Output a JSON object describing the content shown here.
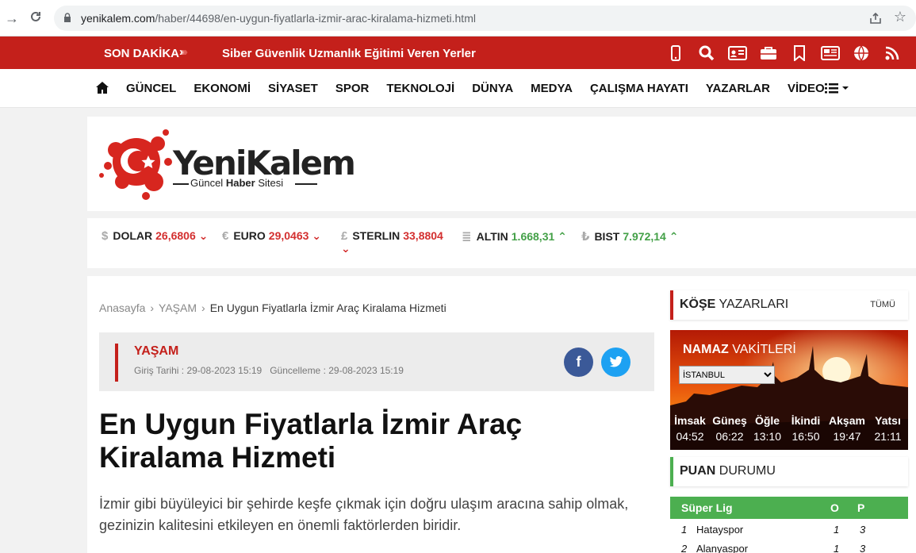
{
  "browser": {
    "url_domain": "yenikalem.com",
    "url_path": "/haber/44698/en-uygun-fiyatlarla-izmir-arac-kiralama-hizmeti.html"
  },
  "breaking": {
    "label": "SON DAKİKA",
    "headline": "Siber Güvenlik Uzmanlık Eğitimi Veren Yerler",
    "icons": [
      "mobile-icon",
      "search-icon",
      "id-card-icon",
      "briefcase-icon",
      "bookmark-icon",
      "newspaper-icon",
      "globe-icon",
      "rss-icon"
    ]
  },
  "nav": {
    "items": [
      "GÜNCEL",
      "EKONOMİ",
      "SİYASET",
      "SPOR",
      "TEKNOLOJİ",
      "DÜNYA",
      "MEDYA",
      "ÇALIŞMA HAYATI",
      "YAZARLAR",
      "VİDEO"
    ]
  },
  "logo": {
    "name": "YeniKalem",
    "sub_pre": "Güncel",
    "sub_bold": "Haber",
    "sub_post": "Sitesi"
  },
  "currency": {
    "items": [
      {
        "symbol": "$",
        "name": "DOLAR",
        "value": "26,6806",
        "trend": "down"
      },
      {
        "symbol": "€",
        "name": "EURO",
        "value": "29,0463",
        "trend": "down"
      },
      {
        "symbol": "£",
        "name": "STERLIN",
        "value": "33,8804",
        "trend": "down"
      },
      {
        "symbol": "≣",
        "name": "ALTIN",
        "value": "1.668,31",
        "trend": "up"
      },
      {
        "symbol": "₺",
        "name": "BIST",
        "value": "7.972,14",
        "trend": "up"
      }
    ]
  },
  "breadcrumb": {
    "home": "Anasayfa",
    "category": "YAŞAM",
    "current": "En Uygun Fiyatlarla İzmir Araç Kiralama Hizmeti"
  },
  "article": {
    "category": "YAŞAM",
    "created": "Giriş Tarihi : 29-08-2023 15:19",
    "updated": "Güncelleme : 29-08-2023 15:19",
    "title": "En Uygun Fiyatlarla İzmir Araç Kiralama Hizmeti",
    "summary": "İzmir gibi büyüleyici bir şehirde keşfe çıkmak için doğru ulaşım aracına sahip olmak, gezinizin kalitesini etkileyen en önemli faktörlerden biridir."
  },
  "sidebar": {
    "columnists": {
      "bold": "KÖŞE",
      "rest": "YAZARLARI",
      "all": "TÜMÜ",
      "accent": "#c4201b"
    },
    "prayer": {
      "bold": "NAMAZ",
      "rest": "VAKİTLERİ",
      "city": "İSTANBUL",
      "times": [
        {
          "name": "İmsak",
          "time": "04:52"
        },
        {
          "name": "Güneş",
          "time": "06:22"
        },
        {
          "name": "Öğle",
          "time": "13:10"
        },
        {
          "name": "İkindi",
          "time": "16:50"
        },
        {
          "name": "Akşam",
          "time": "19:47"
        },
        {
          "name": "Yatsı",
          "time": "21:11"
        }
      ]
    },
    "standings": {
      "bold": "PUAN",
      "rest": "DURUMU",
      "accent": "#4caf50",
      "league": "Süper Lig",
      "col_played": "O",
      "col_points": "P",
      "rows": [
        {
          "rank": "1",
          "team": "Hatayspor",
          "played": "1",
          "points": "3"
        },
        {
          "rank": "2",
          "team": "Alanyaspor",
          "played": "1",
          "points": "3"
        }
      ]
    }
  },
  "colors": {
    "brand_red": "#c4201b",
    "league_green": "#4caf50",
    "facebook": "#3b5998",
    "twitter": "#1da1f2"
  }
}
